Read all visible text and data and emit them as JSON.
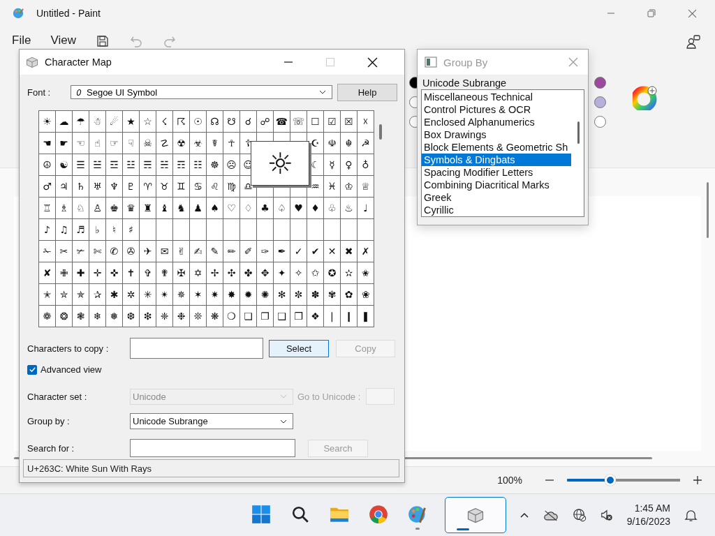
{
  "paint": {
    "title": "Untitled - Paint",
    "menu": [
      "File",
      "View"
    ],
    "palette": [
      {
        "color": "#000000"
      },
      {
        "color": "#ffffff"
      },
      {
        "color": "#ffffff"
      },
      {
        "color": "#9c4a9e"
      },
      {
        "color": "#b7b0dc"
      },
      {
        "color": "#ffffff"
      }
    ],
    "zoom": "100%",
    "zoom_slider": {
      "level": 0.38
    }
  },
  "character_map": {
    "title": "Character Map",
    "maximize_disabled": true,
    "font_label": "Font :",
    "font": "Segoe UI Symbol",
    "help_button": "Help",
    "grid": [
      {
        "cells": [
          "☀",
          "☁",
          "☂",
          "☃",
          "☄",
          "★",
          "☆",
          "☇",
          "☈",
          "☉",
          "☊",
          "☋",
          "☌",
          "☍",
          "☎",
          "☏",
          "☐",
          "☑",
          "☒",
          "☓"
        ]
      },
      {
        "cells": [
          "☚",
          "☛",
          "☜",
          "☝",
          "☞",
          "☟",
          "☠",
          "☡",
          "☢",
          "☣",
          "☤",
          "☥",
          "☦"
        ],
        "right": [
          "☪",
          "☫",
          "☬",
          "☭"
        ]
      },
      {
        "cells": [
          "☮",
          "☯",
          "☰",
          "☱",
          "☲",
          "☳",
          "☴",
          "☵",
          "☶",
          "☷",
          "☸",
          "☹",
          "☺"
        ],
        "right": [
          "☾",
          "☿",
          "♀",
          "♁"
        ]
      },
      {
        "cells": [
          "♂",
          "♃",
          "♄",
          "♅",
          "♆",
          "♇",
          "♈",
          "♉",
          "♊",
          "♋",
          "♌",
          "♍",
          "♎"
        ],
        "right": [
          "♒",
          "♓",
          "♔",
          "♕"
        ]
      },
      {
        "cells": [
          "♖",
          "♗",
          "♘",
          "♙",
          "♚",
          "♛",
          "♜",
          "♝",
          "♞",
          "♟",
          "♠",
          "♡",
          "♢",
          "♣",
          "♤",
          "♥",
          "♦",
          "♧",
          "♨",
          "♩"
        ]
      },
      {
        "cells": [
          "♪",
          "♫",
          "♬",
          "♭",
          "♮",
          "♯"
        ]
      },
      {
        "cells": [
          "✁",
          "✂",
          "✃",
          "✄",
          "✆",
          "✇",
          "✈",
          "✉",
          "✌",
          "✍",
          "✎",
          "✏",
          "✐",
          "✑",
          "✒",
          "✓",
          "✔",
          "✕",
          "✖",
          "✗"
        ]
      },
      {
        "cells": [
          "✘",
          "✙",
          "✚",
          "✛",
          "✜",
          "✝",
          "✞",
          "✟",
          "✠",
          "✡",
          "✢",
          "✣",
          "✤",
          "✥",
          "✦",
          "✧",
          "✩",
          "✪",
          "✫",
          "✬"
        ]
      },
      {
        "cells": [
          "✭",
          "✮",
          "✯",
          "✰",
          "✱",
          "✲",
          "✳",
          "✴",
          "✵",
          "✶",
          "✷",
          "✸",
          "✹",
          "✺",
          "✻",
          "✼",
          "✽",
          "✾",
          "✿",
          "❀"
        ]
      },
      {
        "cells": [
          "❁",
          "❂",
          "❃",
          "❄",
          "❅",
          "❆",
          "❇",
          "❈",
          "❉",
          "❊",
          "❋",
          "❍",
          "❏",
          "❐",
          "❑",
          "❒",
          "❖",
          "❘",
          "❙",
          "❚"
        ]
      }
    ],
    "magnified": "☼",
    "copy_label": "Characters to copy :",
    "select_button": "Select",
    "copy_button": {
      "label": "Copy",
      "disabled": true
    },
    "advanced_view": {
      "label": "Advanced view",
      "checked": true
    },
    "character_set": {
      "label": "Character set :",
      "value": "Unicode",
      "disabled": true
    },
    "go_to_unicode": {
      "label": "Go to Unicode :",
      "disabled": true
    },
    "group_by": {
      "label": "Group by :",
      "value": "Unicode Subrange"
    },
    "search": {
      "label": "Search for :",
      "button": "Search",
      "disabled": true
    },
    "status": "U+263C: White Sun With Rays"
  },
  "group_by_window": {
    "title": "Group By",
    "heading": "Unicode Subrange",
    "items": [
      {
        "label": "Miscellaneous Technical",
        "selected": false
      },
      {
        "label": "Control Pictures & OCR",
        "selected": false
      },
      {
        "label": "Enclosed Alphanumerics",
        "selected": false
      },
      {
        "label": "Box Drawings",
        "selected": false
      },
      {
        "label": "Block Elements & Geometric Sh",
        "selected": false
      },
      {
        "label": "Symbols & Dingbats",
        "selected": true
      },
      {
        "label": "Spacing Modifier Letters",
        "selected": false
      },
      {
        "label": "Combining Diacritical Marks",
        "selected": false
      },
      {
        "label": "Greek",
        "selected": false
      },
      {
        "label": "Cyrillic",
        "selected": false
      }
    ]
  },
  "taskbar": {
    "apps": [
      {
        "kind": "start",
        "selected": false,
        "running": false
      },
      {
        "kind": "search",
        "selected": false,
        "running": false
      },
      {
        "kind": "files",
        "selected": false,
        "running": false
      },
      {
        "kind": "browser",
        "selected": false,
        "running": false
      },
      {
        "kind": "paint",
        "selected": false,
        "running": true
      },
      {
        "kind": "charmap",
        "selected": true,
        "running": true
      }
    ],
    "time": "1:45 AM",
    "date": "9/16/2023"
  }
}
